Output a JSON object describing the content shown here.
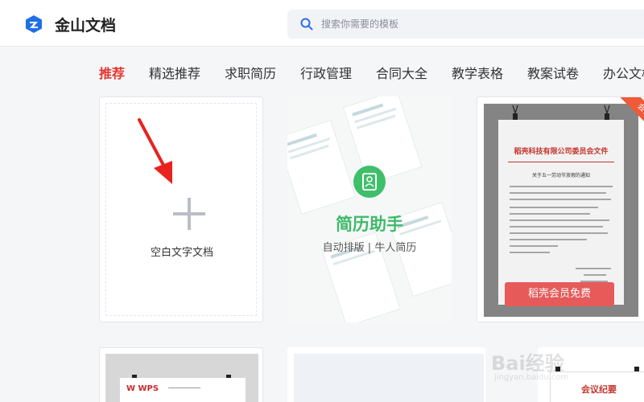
{
  "app": {
    "brand": "金山文档"
  },
  "search": {
    "placeholder": "搜索你需要的模板"
  },
  "tabs": [
    {
      "label": "推荐",
      "active": true
    },
    {
      "label": "精选推荐"
    },
    {
      "label": "求职简历"
    },
    {
      "label": "行政管理"
    },
    {
      "label": "合同大全"
    },
    {
      "label": "教学表格"
    },
    {
      "label": "教案试卷"
    },
    {
      "label": "办公文档"
    }
  ],
  "cards": {
    "blank": {
      "label": "空白文字文档"
    },
    "resume": {
      "title": "简历助手",
      "subtitle": "自动排版 | 牛人简历"
    },
    "member": {
      "ribbon": "会员",
      "doc_title": "稻壳科技有限公司委员会文件",
      "doc_subtitle": "关于五一劳动节放假的通知",
      "button": "稻壳会员免费"
    },
    "bottom1": {
      "logo": "W WPS"
    },
    "bottom3": {
      "title": "会议纪要"
    }
  },
  "watermark": {
    "text": "Bai经验",
    "sub": "jingyan.baidu.com"
  },
  "colors": {
    "accent": "#e5352f",
    "resume_green": "#3dba67",
    "member_button": "#e65a5a"
  }
}
